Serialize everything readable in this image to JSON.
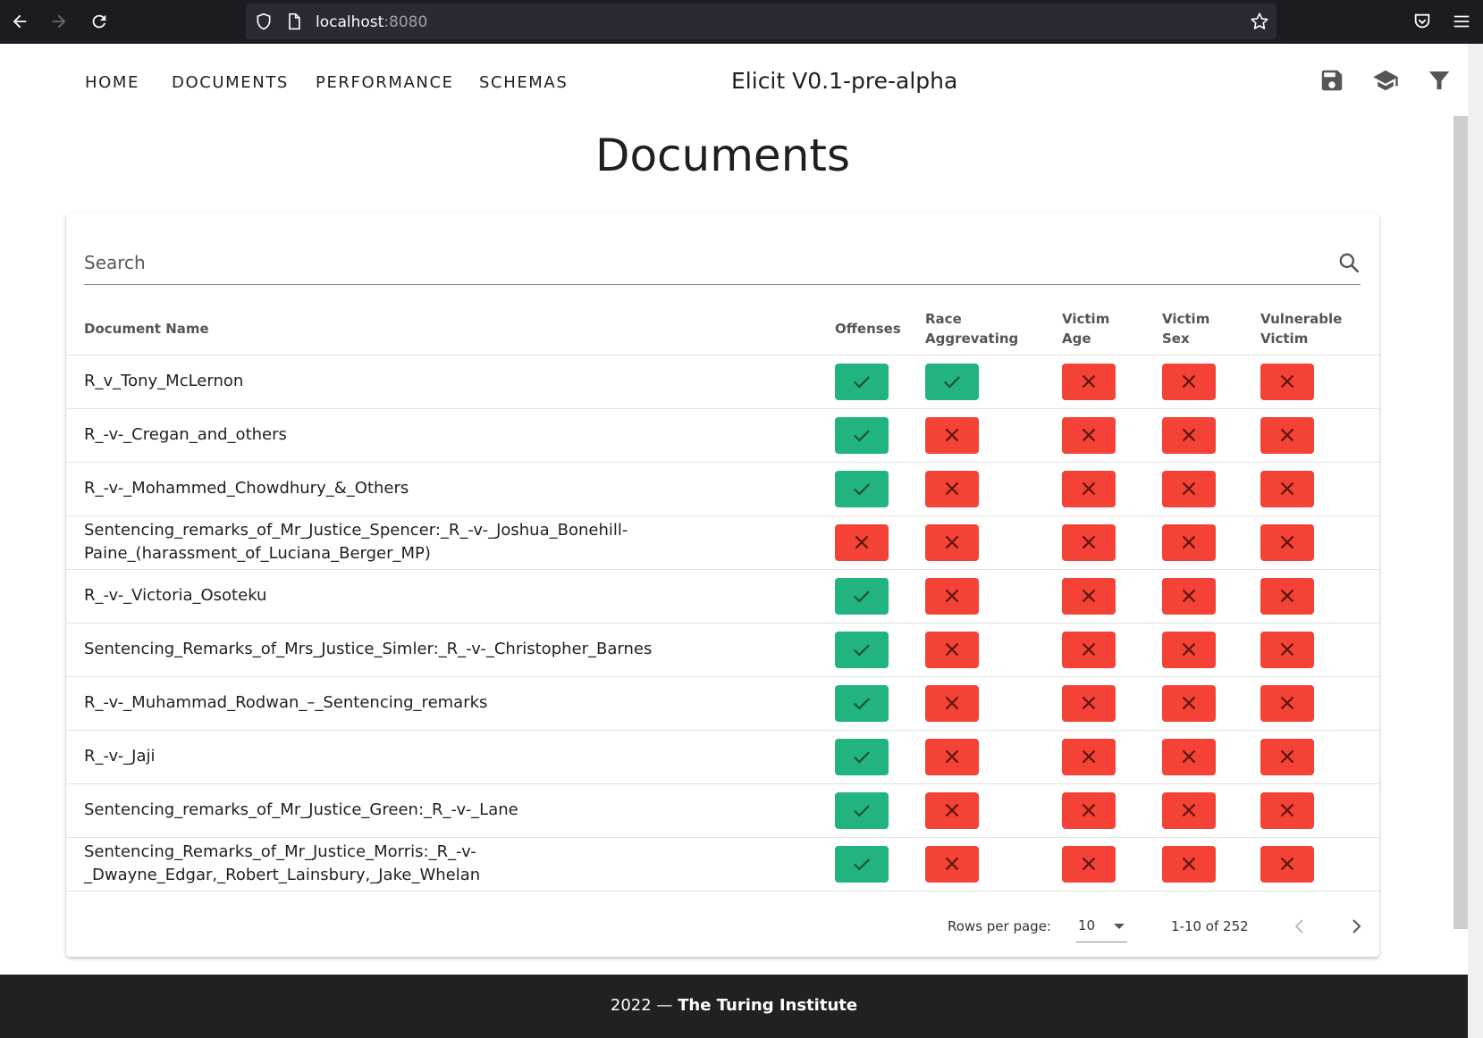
{
  "browser": {
    "url_host": "localhost",
    "url_port": ":8080"
  },
  "nav": {
    "links": [
      "HOME",
      "DOCUMENTS",
      "PERFORMANCE",
      "SCHEMAS"
    ],
    "app_title": "Elicit V0.1-pre-alpha",
    "icons": [
      "save-icon",
      "school-icon",
      "filter-icon"
    ]
  },
  "page": {
    "title": "Documents"
  },
  "search": {
    "placeholder": "Search"
  },
  "table": {
    "headers": {
      "name": "Document Name",
      "offenses": "Offenses",
      "race_line1": "Race",
      "race_line2": "Aggrevating",
      "age_line1": "Victim",
      "age_line2": "Age",
      "sex_line1": "Victim",
      "sex_line2": "Sex",
      "vuln_line1": "Vulnerable",
      "vuln_line2": "Victim"
    },
    "rows": [
      {
        "name": "R_v_Tony_McLernon",
        "offenses": true,
        "race": true,
        "age": false,
        "sex": false,
        "vuln": false
      },
      {
        "name": "R_-v-_Cregan_and_others",
        "offenses": true,
        "race": false,
        "age": false,
        "sex": false,
        "vuln": false
      },
      {
        "name": "R_-v-_Mohammed_Chowdhury_&_Others",
        "offenses": true,
        "race": false,
        "age": false,
        "sex": false,
        "vuln": false
      },
      {
        "name": "Sentencing_remarks_of_Mr_Justice_Spencer:_R_-v-_Joshua_Bonehill-",
        "name2": "Paine_(harassment_of_Luciana_Berger_MP)",
        "offenses": false,
        "race": false,
        "age": false,
        "sex": false,
        "vuln": false
      },
      {
        "name": "R_-v-_Victoria_Osoteku",
        "offenses": true,
        "race": false,
        "age": false,
        "sex": false,
        "vuln": false
      },
      {
        "name": "Sentencing_Remarks_of_Mrs_Justice_Simler:_R_-v-_Christopher_Barnes",
        "offenses": true,
        "race": false,
        "age": false,
        "sex": false,
        "vuln": false
      },
      {
        "name": "R_-v-_Muhammad_Rodwan_–_Sentencing_remarks",
        "offenses": true,
        "race": false,
        "age": false,
        "sex": false,
        "vuln": false
      },
      {
        "name": "R_-v-_Jaji",
        "offenses": true,
        "race": false,
        "age": false,
        "sex": false,
        "vuln": false
      },
      {
        "name": "Sentencing_remarks_of_Mr_Justice_Green:_R_-v-_Lane",
        "offenses": true,
        "race": false,
        "age": false,
        "sex": false,
        "vuln": false
      },
      {
        "name": "Sentencing_Remarks_of_Mr_Justice_Morris:_R_-v-_Dwayne_Edgar,_Robert_Lainsbury,_Jake_Whelan",
        "offenses": true,
        "race": false,
        "age": false,
        "sex": false,
        "vuln": false
      }
    ]
  },
  "pagination": {
    "rows_per_page_label": "Rows per page:",
    "rows_per_page_value": "10",
    "range": "1-10 of 252"
  },
  "footer": {
    "year_text": "2022 — ",
    "org": "The Turing Institute"
  },
  "colors": {
    "yes": "#21b47f",
    "no": "#f44236",
    "footer_bg": "#212121"
  }
}
